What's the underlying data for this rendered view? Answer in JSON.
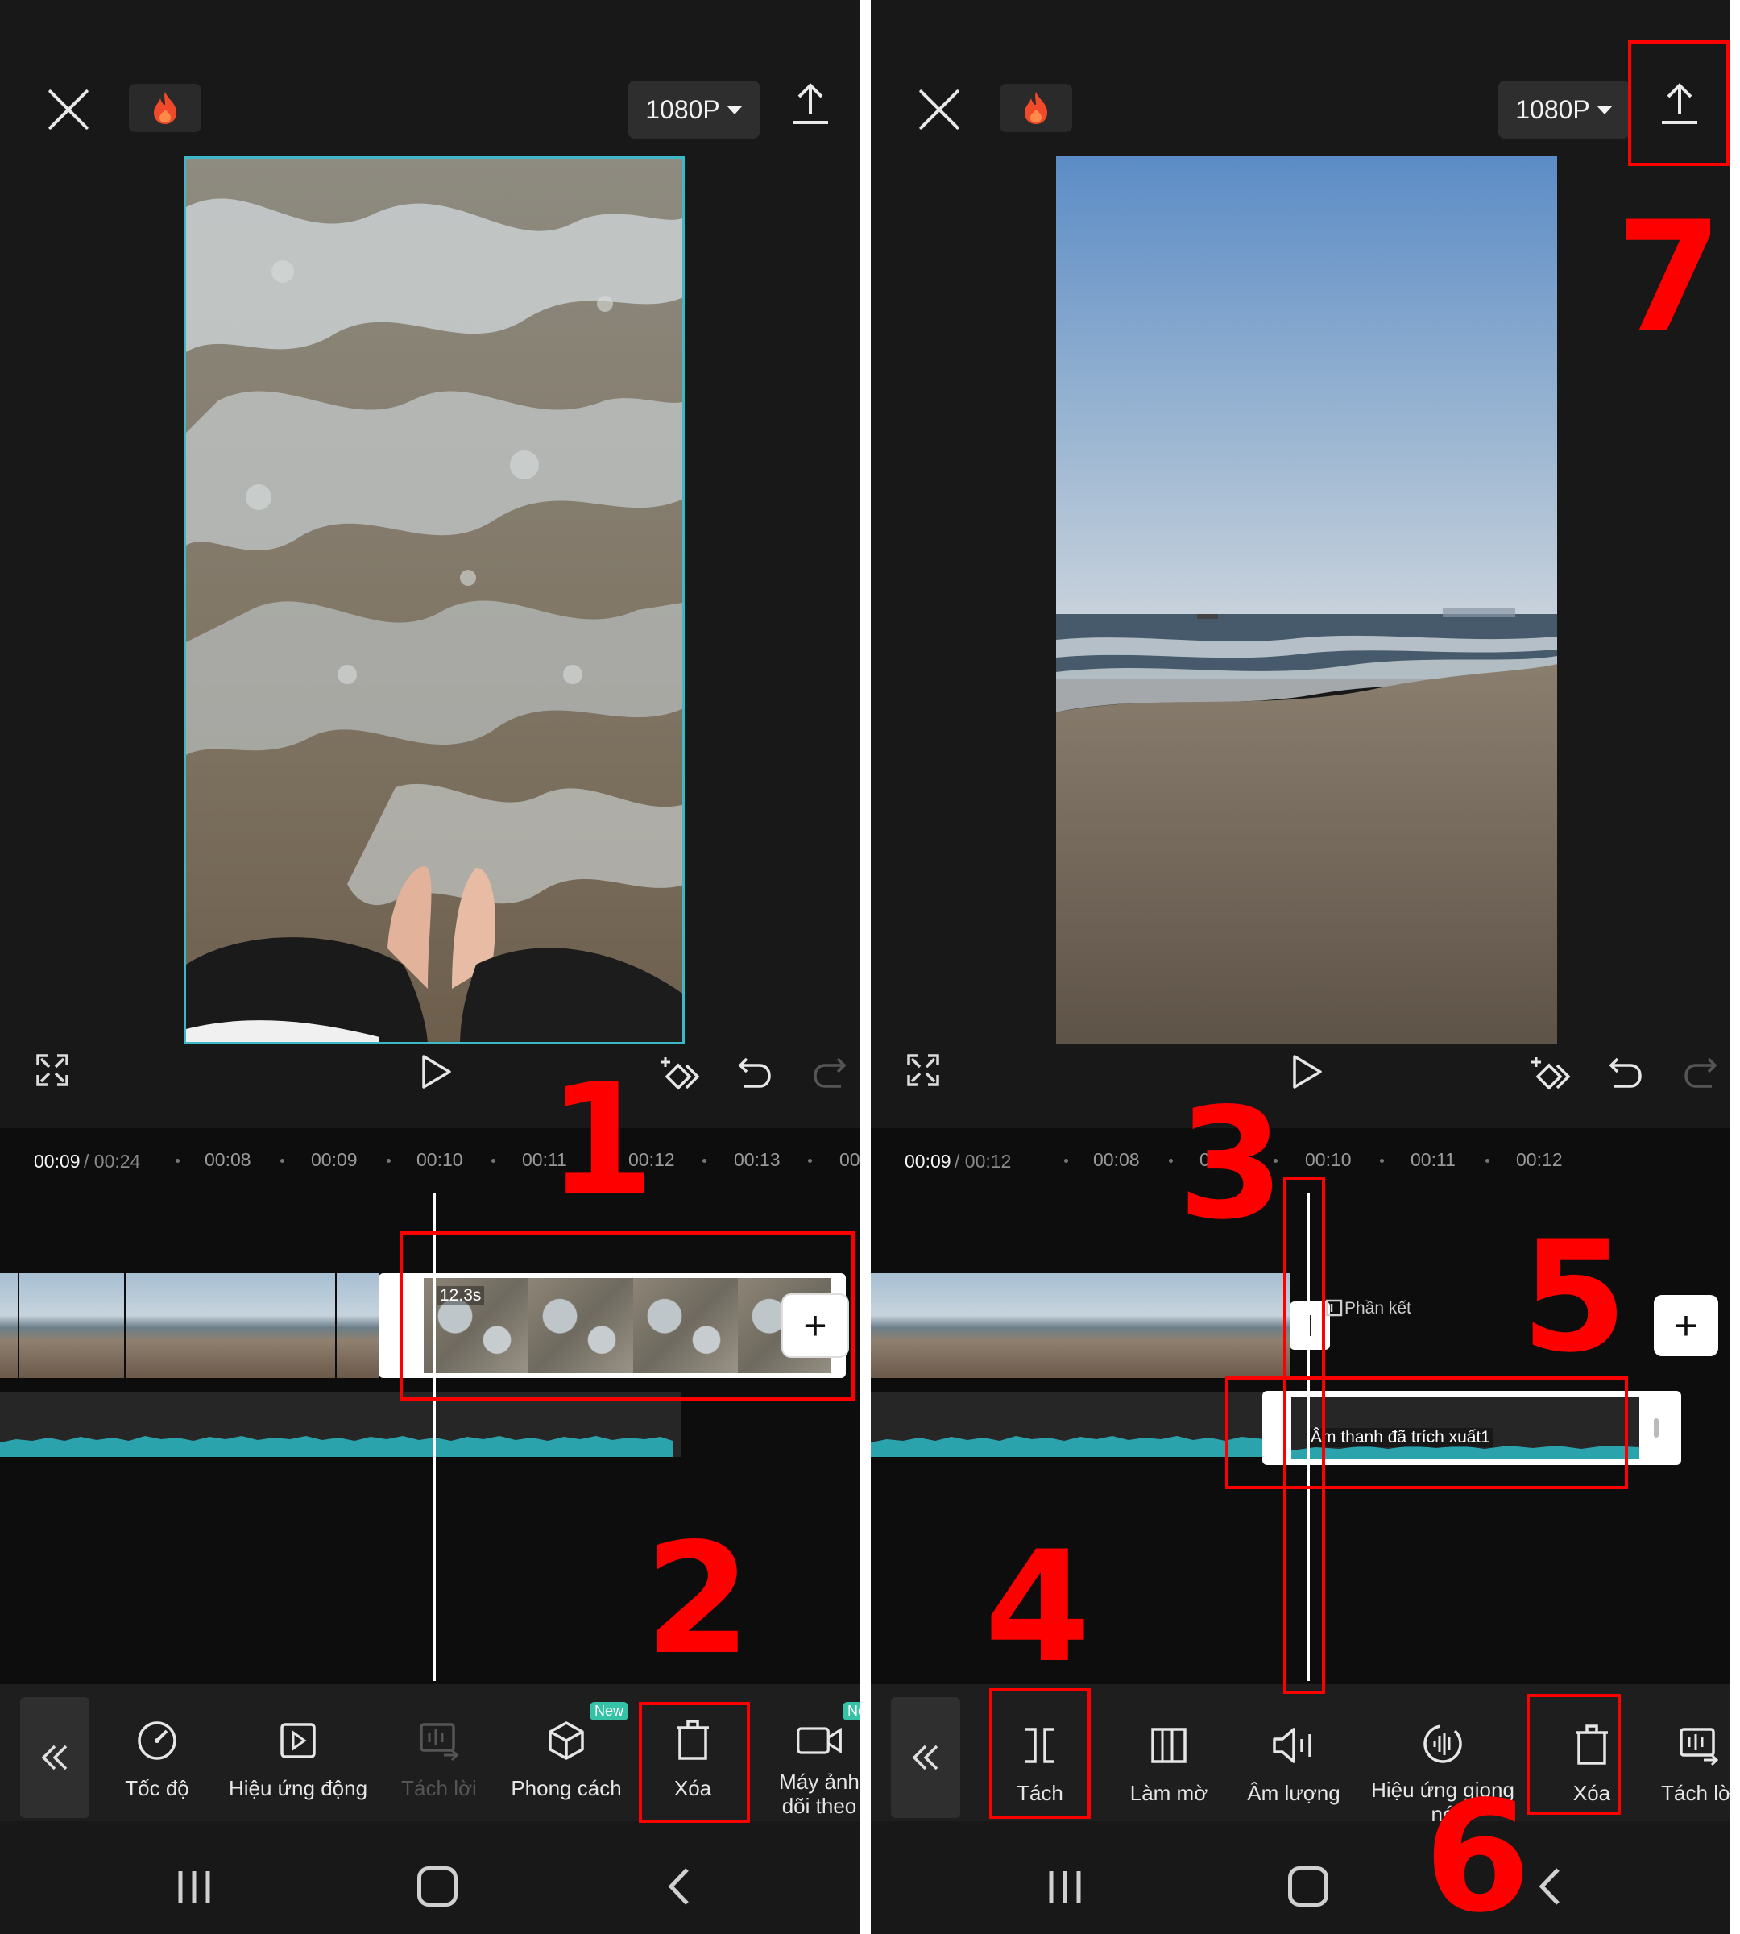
{
  "colors": {
    "background": "#181818",
    "timeline": "#0d0d0d",
    "accent_teal": "#3db8c6",
    "annotation_red": "#ff0000",
    "badge_green": "#35c2a6"
  },
  "left": {
    "resolution": "1080P",
    "time_current": "00:09",
    "time_total": "/ 00:24",
    "ruler": [
      "00:08",
      "00:09",
      "00:10",
      "00:11",
      "00:12",
      "00:13",
      "00"
    ],
    "clip_duration": "12.3s",
    "add_label": "+",
    "toolbar": [
      {
        "icon": "speed-icon",
        "label": "Tốc độ"
      },
      {
        "icon": "motion-effect-icon",
        "label": "Hiệu ứng động"
      },
      {
        "icon": "separate-voice-icon",
        "label": "Tách lời"
      },
      {
        "icon": "style-cube-icon",
        "label": "Phong cách",
        "badge": "New"
      },
      {
        "icon": "delete-icon",
        "label": "Xóa"
      },
      {
        "icon": "camera-tracking-icon",
        "label": "Máy ảnh\ndõi theo",
        "badge": "Ne"
      }
    ]
  },
  "right": {
    "resolution": "1080P",
    "time_current": "00:09",
    "time_total": "/ 00:12",
    "ruler": [
      "00:08",
      "00",
      "00:10",
      "00:11",
      "00:12"
    ],
    "ending_label": "Phần kết",
    "add_label": "+",
    "audio_label": "Âm thanh đã trích xuất1",
    "toolbar": [
      {
        "icon": "split-icon",
        "label": "Tách"
      },
      {
        "icon": "blur-icon",
        "label": "Làm mờ"
      },
      {
        "icon": "volume-icon",
        "label": "Âm lượng"
      },
      {
        "icon": "voice-effect-icon",
        "label": "Hiệu ứng giọng\nnó"
      },
      {
        "icon": "delete-icon",
        "label": "Xóa"
      },
      {
        "icon": "separate-voice-icon",
        "label": "Tách lời"
      }
    ]
  },
  "annotations": [
    "1",
    "2",
    "3",
    "4",
    "5",
    "6",
    "7"
  ]
}
